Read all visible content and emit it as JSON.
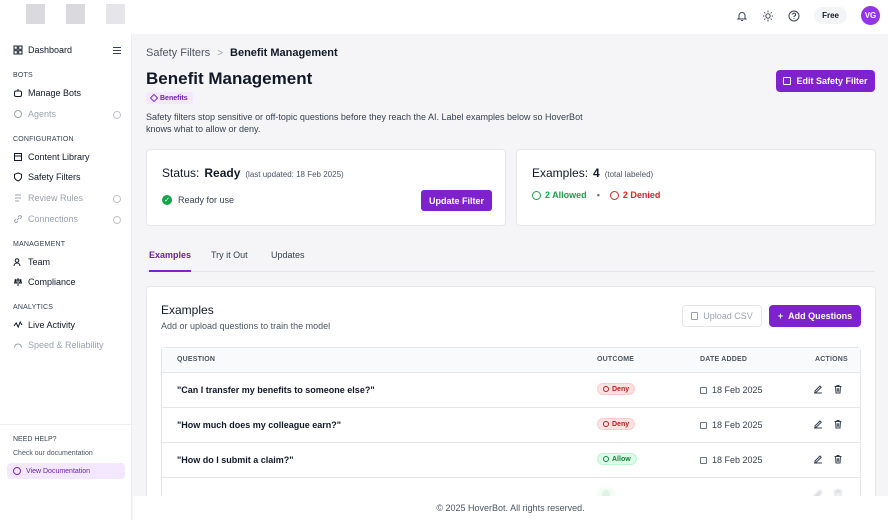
{
  "topbar": {
    "plan": "Free",
    "avatar_initials": "VG",
    "icons": [
      "bell-icon",
      "sun-icon",
      "help-icon"
    ]
  },
  "sidebar": {
    "dashboard": "Dashboard",
    "sections": {
      "bots": "BOTS",
      "configuration": "CONFIGURATION",
      "management": "MANAGEMENT",
      "analytics": "ANALYTICS"
    },
    "items": {
      "manage_bots": "Manage Bots",
      "agents": "Agents",
      "content_library": "Content Library",
      "safety_filters": "Safety Filters",
      "review_rules": "Review Rules",
      "connections": "Connections",
      "team": "Team",
      "compliance": "Compliance",
      "live_activity": "Live Activity",
      "speed_reliability": "Speed & Reliability"
    },
    "help": {
      "title": "NEED HELP?",
      "subtitle": "Check our documentation",
      "link": "View Documentation"
    }
  },
  "breadcrumb": {
    "parent": "Safety Filters",
    "separator": ">",
    "current": "Benefit Management"
  },
  "page": {
    "title": "Benefit Management",
    "tag": "Benefits",
    "description": "Safety filters stop sensitive or off-topic questions before they reach the AI. Label examples below so HoverBot knows what to allow or deny.",
    "edit_button": "Edit Safety Filter"
  },
  "status_card": {
    "label": "Status:",
    "value": "Ready",
    "updated": "(last updated: 18 Feb 2025)",
    "ready_text": "Ready for use",
    "button": "Update Filter"
  },
  "examples_card": {
    "label": "Examples:",
    "value": "4",
    "sub": "(total labeled)",
    "allowed": "2 Allowed",
    "separator": "•",
    "denied": "2 Denied"
  },
  "tabs": [
    "Examples",
    "Try it Out",
    "Updates"
  ],
  "examples_section": {
    "title": "Examples",
    "subtitle": "Add or upload questions to train the model",
    "upload_button": "Upload CSV",
    "add_button": "Add Questions",
    "columns": [
      "QUESTION",
      "OUTCOME",
      "DATE ADDED",
      "ACTIONS"
    ],
    "rows": [
      {
        "question": "\"Can I transfer my benefits to someone else?\"",
        "outcome": "Deny",
        "date": "18 Feb 2025"
      },
      {
        "question": "\"How much does my colleague earn?\"",
        "outcome": "Deny",
        "date": "18 Feb 2025"
      },
      {
        "question": "\"How do I submit a claim?\"",
        "outcome": "Allow",
        "date": "18 Feb 2025"
      }
    ]
  },
  "footer": "© 2025 HoverBot. All rights reserved.",
  "colors": {
    "accent": "#7e22ce",
    "allow": "#16a34a",
    "deny": "#dc2626"
  }
}
